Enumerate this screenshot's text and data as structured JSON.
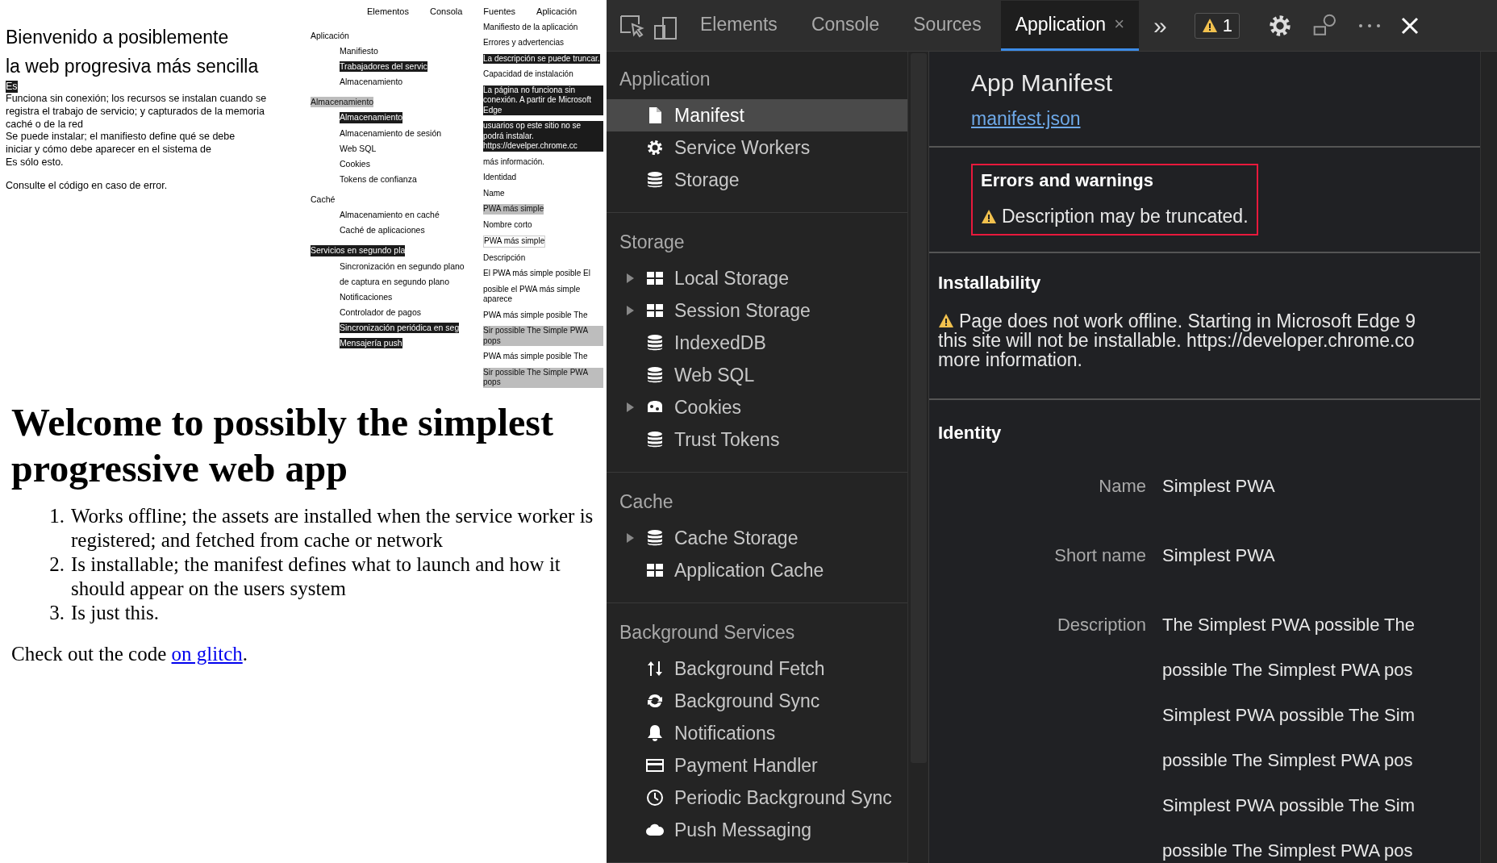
{
  "page": {
    "heading": "Welcome to possibly the simplest progressive web app",
    "list": [
      {
        "number": "1.",
        "text": "Works offline; the assets are installed when the service worker is registered; and fetched from cache or network"
      },
      {
        "number": "2.",
        "text": "Is installable; the manifest defines what to launch and how it should appear on the users system"
      },
      {
        "number": "3.",
        "text": "Is just this."
      }
    ],
    "footer": {
      "text": "Check out the code ",
      "link": "on glitch",
      "end": "."
    }
  },
  "translation_overlay": {
    "tabs": [
      "Elementos",
      "Consola",
      "Fuentes",
      "Aplicación"
    ],
    "page": [
      {
        "text": "Bienvenido a posiblemente",
        "kind": "plain"
      },
      {
        "text": "la web progresiva más sencilla",
        "kind": "plain"
      },
      {
        "text": "Es",
        "kind": "dark"
      },
      {
        "text": "Funciona sin conexión; los recursos se instalan cuando se",
        "kind": "plain"
      },
      {
        "text": "registra el trabajo de servicio; y capturados de la memoria",
        "kind": "plain"
      },
      {
        "text": "caché o de la red",
        "kind": "plain"
      },
      {
        "text": "Se puede instalar; el manifiesto define qué se debe",
        "kind": "plain"
      },
      {
        "text": "iniciar y cómo debe aparecer en el sistema de",
        "kind": "plain"
      },
      {
        "text": "Es sólo esto.",
        "kind": "plain"
      },
      {
        "text": "Consulte el código en caso de error.",
        "kind": "plain"
      }
    ],
    "sidebar": [
      {
        "title": {
          "text": "Aplicación",
          "kind": "plain"
        },
        "items": [
          {
            "text": "Manifiesto",
            "kind": "plain"
          },
          {
            "text": "Trabajadores del servic",
            "kind": "dark"
          },
          {
            "text": "Almacenamiento",
            "kind": "plain"
          }
        ]
      },
      {
        "title": {
          "text": "Almacenamiento",
          "kind": "grey"
        },
        "items": [
          {
            "text": "Almacenamiento",
            "kind": "dark"
          },
          {
            "text": "Almacenamiento de sesión",
            "kind": "plain"
          },
          {
            "text": "Web SQL",
            "kind": "plain"
          },
          {
            "text": "Cookies",
            "kind": "plain"
          },
          {
            "text": "Tokens de confianza",
            "kind": "plain"
          }
        ]
      },
      {
        "title": {
          "text": "Caché",
          "kind": "plain"
        },
        "items": [
          {
            "text": "Almacenamiento en caché",
            "kind": "plain"
          },
          {
            "text": "Caché de aplicaciones",
            "kind": "plain"
          }
        ]
      },
      {
        "title": {
          "text": "Servicios en segundo pla",
          "kind": "dark"
        },
        "items": [
          {
            "text": "Sincronización en segundo plano",
            "kind": "plain"
          },
          {
            "text": "de captura en segundo plano",
            "kind": "plain"
          },
          {
            "text": "Notificaciones",
            "kind": "plain"
          },
          {
            "text": "Controlador de pagos",
            "kind": "plain"
          },
          {
            "text": "Sincronización periódica en seg",
            "kind": "dark"
          },
          {
            "text": "Mensajería push",
            "kind": "dark"
          }
        ]
      }
    ],
    "manifest": [
      {
        "text": "Manifiesto de la aplicación",
        "kind": "plain"
      },
      {
        "text": "Errores y advertencias",
        "kind": "plain"
      },
      {
        "text": "La descripción se puede truncar.",
        "kind": "dark"
      },
      {
        "text": "Capacidad de instalación",
        "kind": "plain"
      },
      {
        "text": "La página no funciona sin conexión. A partir de Microsoft Edge",
        "kind": "dark"
      },
      {
        "text": "usuarios op este sitio no se podrá instalar. https://develper.chrome.cc",
        "kind": "dark"
      },
      {
        "text": "más información.",
        "kind": "plain"
      },
      {
        "text": "Identidad",
        "kind": "plain"
      },
      {
        "text": "Name",
        "kind": "plain"
      },
      {
        "text": "PWA más simple",
        "kind": "grey"
      },
      {
        "text": "Nombre corto",
        "kind": "plain"
      },
      {
        "text": "PWA más simple",
        "kind": "light"
      },
      {
        "text": "Descripción",
        "kind": "plain"
      },
      {
        "text": "El PWA más simple posible El",
        "kind": "plain"
      },
      {
        "text": "posible el PWA más simple aparece",
        "kind": "plain"
      },
      {
        "text": "PWA más simple posible The",
        "kind": "plain"
      },
      {
        "text": "Sir possible The Simple PWA pops",
        "kind": "grey"
      },
      {
        "text": "PWA más simple posible The",
        "kind": "plain"
      },
      {
        "text": "Sir possible The Simple PWA pops",
        "kind": "grey"
      }
    ]
  },
  "devtools": {
    "tabs": [
      {
        "label": "Elements",
        "selected": false
      },
      {
        "label": "Console",
        "selected": false
      },
      {
        "label": "Sources",
        "selected": false
      },
      {
        "label": "Application",
        "selected": true,
        "close": "×"
      }
    ],
    "more_tabs": "»",
    "warning_count": "1",
    "sidebar": [
      {
        "title": "Application",
        "items": [
          {
            "label": "Manifest",
            "arrow": false,
            "selected": true
          },
          {
            "label": "Service Workers",
            "arrow": false,
            "selected": false
          },
          {
            "label": "Storage",
            "arrow": false,
            "selected": false
          }
        ]
      },
      {
        "title": "Storage",
        "items": [
          {
            "label": "Local Storage",
            "arrow": true,
            "selected": false
          },
          {
            "label": "Session Storage",
            "arrow": true,
            "selected": false
          },
          {
            "label": "IndexedDB",
            "arrow": false,
            "selected": false
          },
          {
            "label": "Web SQL",
            "arrow": false,
            "selected": false
          },
          {
            "label": "Cookies",
            "arrow": true,
            "selected": false
          },
          {
            "label": "Trust Tokens",
            "arrow": false,
            "selected": false
          }
        ]
      },
      {
        "title": "Cache",
        "items": [
          {
            "label": "Cache Storage",
            "arrow": true,
            "selected": false
          },
          {
            "label": "Application Cache",
            "arrow": false,
            "selected": false
          }
        ]
      },
      {
        "title": "Background Services",
        "items": [
          {
            "label": "Background Fetch",
            "arrow": false,
            "selected": false
          },
          {
            "label": "Background Sync",
            "arrow": false,
            "selected": false
          },
          {
            "label": "Notifications",
            "arrow": false,
            "selected": false
          },
          {
            "label": "Payment Handler",
            "arrow": false,
            "selected": false
          },
          {
            "label": "Periodic Background Sync",
            "arrow": false,
            "selected": false
          },
          {
            "label": "Push Messaging",
            "arrow": false,
            "selected": false
          }
        ]
      }
    ],
    "manifest": {
      "title": "App Manifest",
      "link": "manifest.json",
      "errors": {
        "title": "Errors and warnings",
        "messages": [
          "Description may be truncated."
        ]
      },
      "installability": {
        "title": "Installability",
        "lines": [
          "Page does not work offline. Starting in Microsoft Edge 9",
          "this site will not be installable. https://developer.chrome.co",
          "more information."
        ]
      },
      "identity": {
        "title": "Identity",
        "rows": [
          {
            "label": "Name",
            "values": [
              "Simplest PWA"
            ]
          },
          {
            "label": "Short name",
            "values": [
              "Simplest PWA"
            ]
          },
          {
            "label": "Description",
            "values": [
              "The Simplest PWA possible The",
              "possible The Simplest PWA pos",
              "Simplest PWA possible The Sim",
              "possible The Simplest PWA pos",
              "Simplest PWA possible The Sim",
              "possible The Simplest PWA pos"
            ]
          }
        ]
      }
    }
  }
}
